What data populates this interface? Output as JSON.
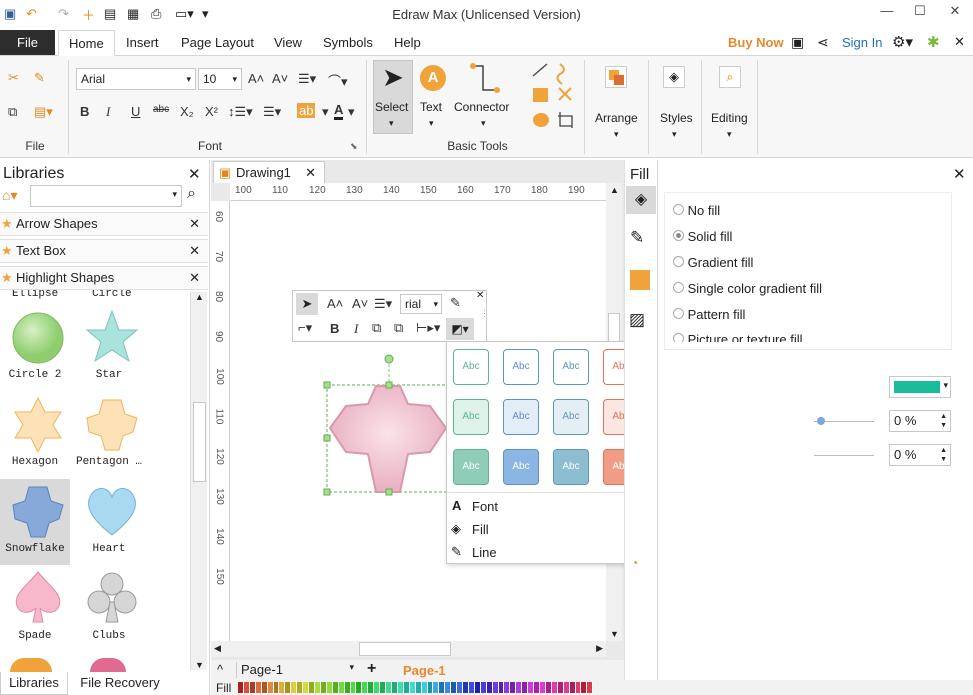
{
  "app": {
    "title": "Edraw Max (Unlicensed Version)"
  },
  "menu": {
    "file": "File",
    "tabs": [
      "Home",
      "Insert",
      "Page Layout",
      "View",
      "Symbols",
      "Help"
    ],
    "buy_now": "Buy Now",
    "sign_in": "Sign In"
  },
  "ribbon": {
    "font_name": "Arial",
    "font_size": "10",
    "groups": {
      "file": "File",
      "font": "Font",
      "basic_tools": "Basic Tools"
    },
    "tools": {
      "select": "Select",
      "text": "Text",
      "connector": "Connector",
      "arrange": "Arrange",
      "styles": "Styles",
      "editing": "Editing"
    }
  },
  "libraries": {
    "header": "Libraries",
    "categories": [
      "Arrow Shapes",
      "Text Box",
      "Highlight Shapes"
    ],
    "partial_top": [
      "Ellipse",
      "Circle"
    ],
    "shapes": [
      "Circle 2",
      "Star",
      "Hexagon",
      "Pentagon …",
      "Snowflake",
      "Heart",
      "Spade",
      "Clubs"
    ]
  },
  "document": {
    "tab": "Drawing1",
    "ruler_h": [
      "100",
      "110",
      "120",
      "130",
      "140",
      "150",
      "160",
      "170",
      "180",
      "190"
    ],
    "ruler_v": [
      "60",
      "70",
      "80",
      "90",
      "100",
      "110",
      "120",
      "130",
      "140",
      "150"
    ]
  },
  "mini_toolbar": {
    "font": "rial"
  },
  "fill_panel": {
    "header": "Fill",
    "options": [
      "No fill",
      "Solid fill",
      "Gradient fill",
      "Single color gradient fill",
      "Pattern fill",
      "Picture or texture fill"
    ],
    "selected": "Solid fill",
    "color": "#1abc9c",
    "value1": "0 %",
    "value2": "0 %"
  },
  "style_popup": {
    "swatch_label": "Abc",
    "menu": [
      "Font",
      "Fill",
      "Line"
    ],
    "rows": [
      [
        "#ffffff",
        "#ffffff",
        "#ffffff",
        "#ffffff",
        "#ffffff",
        "#ffffff",
        "#ffffff"
      ],
      [
        "#dff2ea",
        "#e3edf7",
        "#e3eff2",
        "#fbe6e1",
        "#fdf0e0",
        "#fbe8ee",
        "#e8ebf1"
      ],
      [
        "#8fcdb8",
        "#8bb6e3",
        "#8dbdd0",
        "#ef9d87",
        "#f7bf7a",
        "#e09aac",
        "#8d9cb2"
      ]
    ],
    "borders": [
      "#5ab593",
      "#5b92cf",
      "#5a9ab6",
      "#e07358",
      "#eda24c",
      "#cf6f89",
      "#5f7191"
    ]
  },
  "pages": {
    "current": "Page-1",
    "active": "Page-1"
  },
  "bottom_tabs": {
    "libraries": "Libraries",
    "file_recovery": "File Recovery"
  },
  "status": {
    "fill_label": "Fill"
  }
}
